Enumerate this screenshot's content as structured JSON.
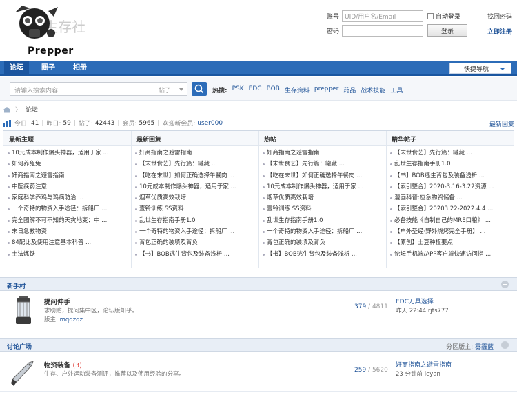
{
  "header": {
    "logo_text": "Prepper",
    "logo_watermark": "生存社",
    "account_label": "账号",
    "account_placeholder": "UID/用户名/Email",
    "password_label": "密码",
    "auto_login_label": "自动登录",
    "forgot_password": "找回密码",
    "login_button": "登录",
    "register_link": "立即注册"
  },
  "nav": {
    "items": [
      "论坛",
      "圈子",
      "相册"
    ],
    "active": "论坛",
    "quick_nav": "快捷导航"
  },
  "search": {
    "placeholder": "请输入搜索内容",
    "type": "帖子",
    "hot_label": "热搜:",
    "hot_terms": [
      "PSK",
      "EDC",
      "BOB",
      "生存资料",
      "prepper",
      "药品",
      "战术技能",
      "工具"
    ]
  },
  "breadcrumb": {
    "current": "论坛"
  },
  "stats": {
    "today_label": "今日:",
    "today": "41",
    "yesterday_label": "昨日:",
    "yesterday": "59",
    "posts_label": "帖子:",
    "posts": "42443",
    "members_label": "会员:",
    "members": "5965",
    "welcome_label": "欢迎新会员:",
    "new_member": "user000",
    "latest_reply_link": "最新回复"
  },
  "columns": [
    {
      "title": "最新主题",
      "items": [
        "10元成本制作爆头神器，适用于家 ...",
        "如何养兔兔",
        "奸商指南之避雷指南",
        "中医疾药注意",
        "家庭科学养鸡与鸡病防治 ...",
        "一个奇特的物资入手途径：拆船厂 ...",
        "完全图解不可不知的天灾地变：中 ...",
        "末日急救物资",
        "84配比及使用注意基本科普 ...",
        "土法炼铁"
      ]
    },
    {
      "title": "最新回复",
      "items": [
        "奸商指南之避雷指南",
        "【末世食艺】先行篇：罐藏 ...",
        "【吃在末世】如何正确选择午餐肉 ...",
        "10元成本制作爆头神器，适用于家 ...",
        "烟草优质高效栽培",
        "壹铃训练 SS资料",
        "乱世生存指南手册1.0",
        "一个奇特的物资入手途径：拆船厂 ...",
        "背包正确的装填及背负",
        "【书】BOB逃生背包及装备浅析 ..."
      ]
    },
    {
      "title": "热帖",
      "items": [
        "奸商指南之避雷指南",
        "【末世食艺】先行篇：罐藏 ...",
        "【吃在末世】如何正确选择午餐肉 ...",
        "10元成本制作爆头神器，适用于家 ...",
        "烟草优质高效栽培",
        "壹铃训练 SS资料",
        "乱世生存指南手册1.0",
        "一个奇特的物资入手途径：拆船厂 ...",
        "背包正确的装填及背负",
        "【书】BOB逃生背包及装备浅析 ..."
      ]
    },
    {
      "title": "精华帖子",
      "items": [
        "【末世食艺】先行篇：罐藏 ...",
        "乱世生存指南手册1.0",
        "【书】BOB逃生背包及装备浅析 ...",
        "【索引整合】2020-3.16-3.22资源 ...",
        "漫画科普:应急物资储备 ...",
        "【索引整合】20203.22-2022.4.4 ...",
        "必备技能《自制自己的MRE口粮》 ...",
        "【户外圣经·野外烧烤完全手册】 ...",
        "【原创】土豆种植要点",
        "论坛手机端/APP客户端快速访问指 ..."
      ]
    }
  ],
  "sections": [
    {
      "title": "新手村",
      "moderator_label": "",
      "moderator": "",
      "forum": {
        "name": "提问伸手",
        "today": "",
        "desc": "求助贴，提问集中区，论坛版知乎。",
        "mod_label": "版主:",
        "mod": "mqqzqz",
        "threads": "379",
        "posts": "4811",
        "last_post": "EDC刀具选择",
        "last_time": "昨天 22:44 rjts777",
        "icon": "lantern-icon"
      }
    },
    {
      "title": "讨论广场",
      "moderator_label": "分区版主:",
      "moderator": "雾霾蓝",
      "forum": {
        "name": "物资装备",
        "today": "(3)",
        "desc": "生存、户外运动装备测评，推荐以及使用经验的分享。",
        "mod_label": "",
        "mod": "",
        "threads": "259",
        "posts": "5620",
        "last_post": "奸商指南之避雷指南",
        "last_time": "23 分钟前 leyan",
        "icon": "knife-icon"
      }
    }
  ],
  "colors": {
    "nav_blue": "#2c6cb8",
    "link_blue": "#225599",
    "today_red": "#e0443e"
  }
}
